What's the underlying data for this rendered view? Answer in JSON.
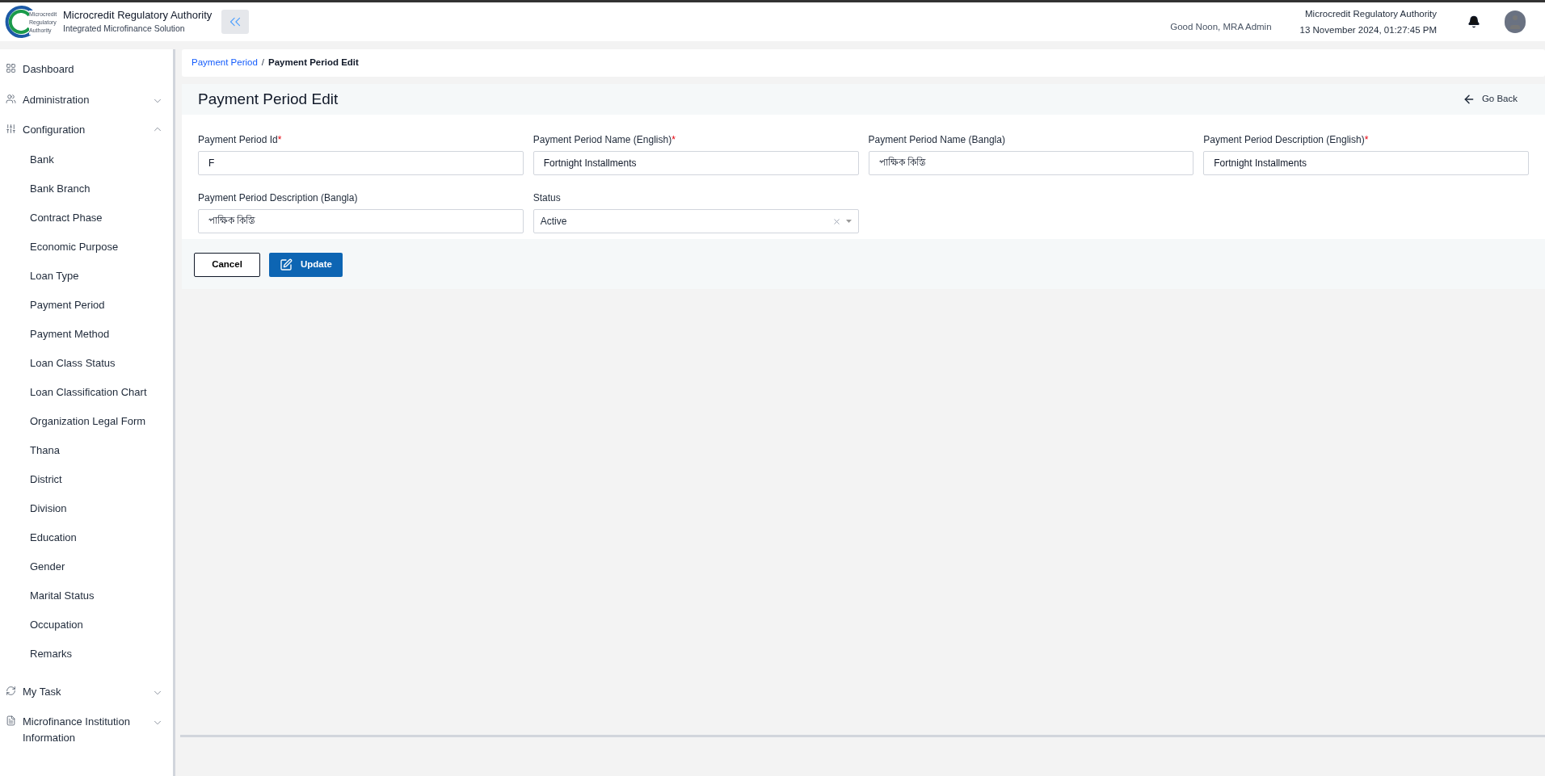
{
  "header": {
    "title": "Microcredit Regulatory Authority",
    "subtitle": "Integrated Microfinance Solution",
    "logo_text": [
      "Microcredit",
      "Regulatory",
      "Authority"
    ],
    "greeting": "Good Noon, MRA Admin",
    "org": "Microcredit Regulatory Authority",
    "datetime": "13 November 2024, 01:27:45 PM"
  },
  "sidebar": {
    "items": [
      {
        "label": "Dashboard",
        "kind": "link"
      },
      {
        "label": "Administration",
        "kind": "group",
        "expanded": false
      },
      {
        "label": "Configuration",
        "kind": "group",
        "expanded": true,
        "children": [
          {
            "label": "Bank"
          },
          {
            "label": "Bank Branch"
          },
          {
            "label": "Contract Phase"
          },
          {
            "label": "Economic Purpose"
          },
          {
            "label": "Loan Type"
          },
          {
            "label": "Payment Period"
          },
          {
            "label": "Payment Method"
          },
          {
            "label": "Loan Class Status"
          },
          {
            "label": "Loan Classification Chart"
          },
          {
            "label": "Organization Legal Form"
          },
          {
            "label": "Thana"
          },
          {
            "label": "District"
          },
          {
            "label": "Division"
          },
          {
            "label": "Education"
          },
          {
            "label": "Gender"
          },
          {
            "label": "Marital Status"
          },
          {
            "label": "Occupation"
          },
          {
            "label": "Remarks"
          }
        ]
      },
      {
        "label": "My Task",
        "kind": "group",
        "expanded": false
      },
      {
        "label": "Microfinance Institution Information",
        "kind": "group",
        "expanded": false
      }
    ]
  },
  "breadcrumb": [
    {
      "label": "Payment Period",
      "kind": "link"
    },
    {
      "label": "/",
      "kind": "separator"
    },
    {
      "label": "Payment Period Edit",
      "kind": "current"
    }
  ],
  "page": {
    "title": "Payment Period Edit",
    "back": "Go Back"
  },
  "fields": [
    {
      "label": "Payment Period Id",
      "required_mark": "*",
      "kind": "text",
      "value": "F"
    },
    {
      "label": "Payment Period Name (English)",
      "required_mark": "*",
      "kind": "text",
      "value": "Fortnight Installments"
    },
    {
      "label": "Payment Period Name (Bangla)",
      "kind": "text",
      "value": "পাক্ষিক কিস্তি"
    },
    {
      "label": "Payment Period Description (English)",
      "required_mark": "*",
      "kind": "text",
      "value": "Fortnight Installments"
    },
    {
      "label": "Payment Period Description (Bangla)",
      "kind": "text",
      "value": "পাক্ষিক কিস্তি"
    },
    {
      "label": "Status",
      "kind": "select",
      "value": "Active"
    }
  ],
  "buttons": [
    {
      "label": "Cancel",
      "kind": "outline"
    },
    {
      "label": "Update",
      "kind": "primary"
    }
  ]
}
